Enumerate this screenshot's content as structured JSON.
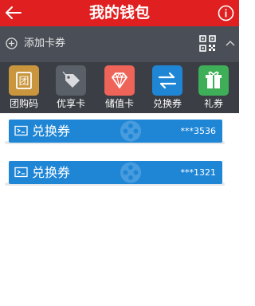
{
  "header": {
    "title": "我的钱包"
  },
  "add_bar": {
    "label": "添加卡券"
  },
  "categories": [
    {
      "label": "团购码",
      "icon": "group-buy-icon",
      "color": "#c9963e"
    },
    {
      "label": "优享卡",
      "icon": "tag-card-icon",
      "color": "#5a6068"
    },
    {
      "label": "储值卡",
      "icon": "diamond-icon",
      "color": "#ee6458"
    },
    {
      "label": "兑换券",
      "icon": "exchange-arrows-icon",
      "color": "#1f86d6"
    },
    {
      "label": "礼券",
      "icon": "gift-icon",
      "color": "#3fae58"
    }
  ],
  "coupons": [
    {
      "name": "兑换券",
      "number": "***3536"
    },
    {
      "name": "兑换券",
      "number": "***1321"
    }
  ],
  "colors": {
    "header": "#e02020",
    "add_bar": "#4a4e56",
    "category_bar": "#3b3e44",
    "coupon": "#1f86d6"
  }
}
